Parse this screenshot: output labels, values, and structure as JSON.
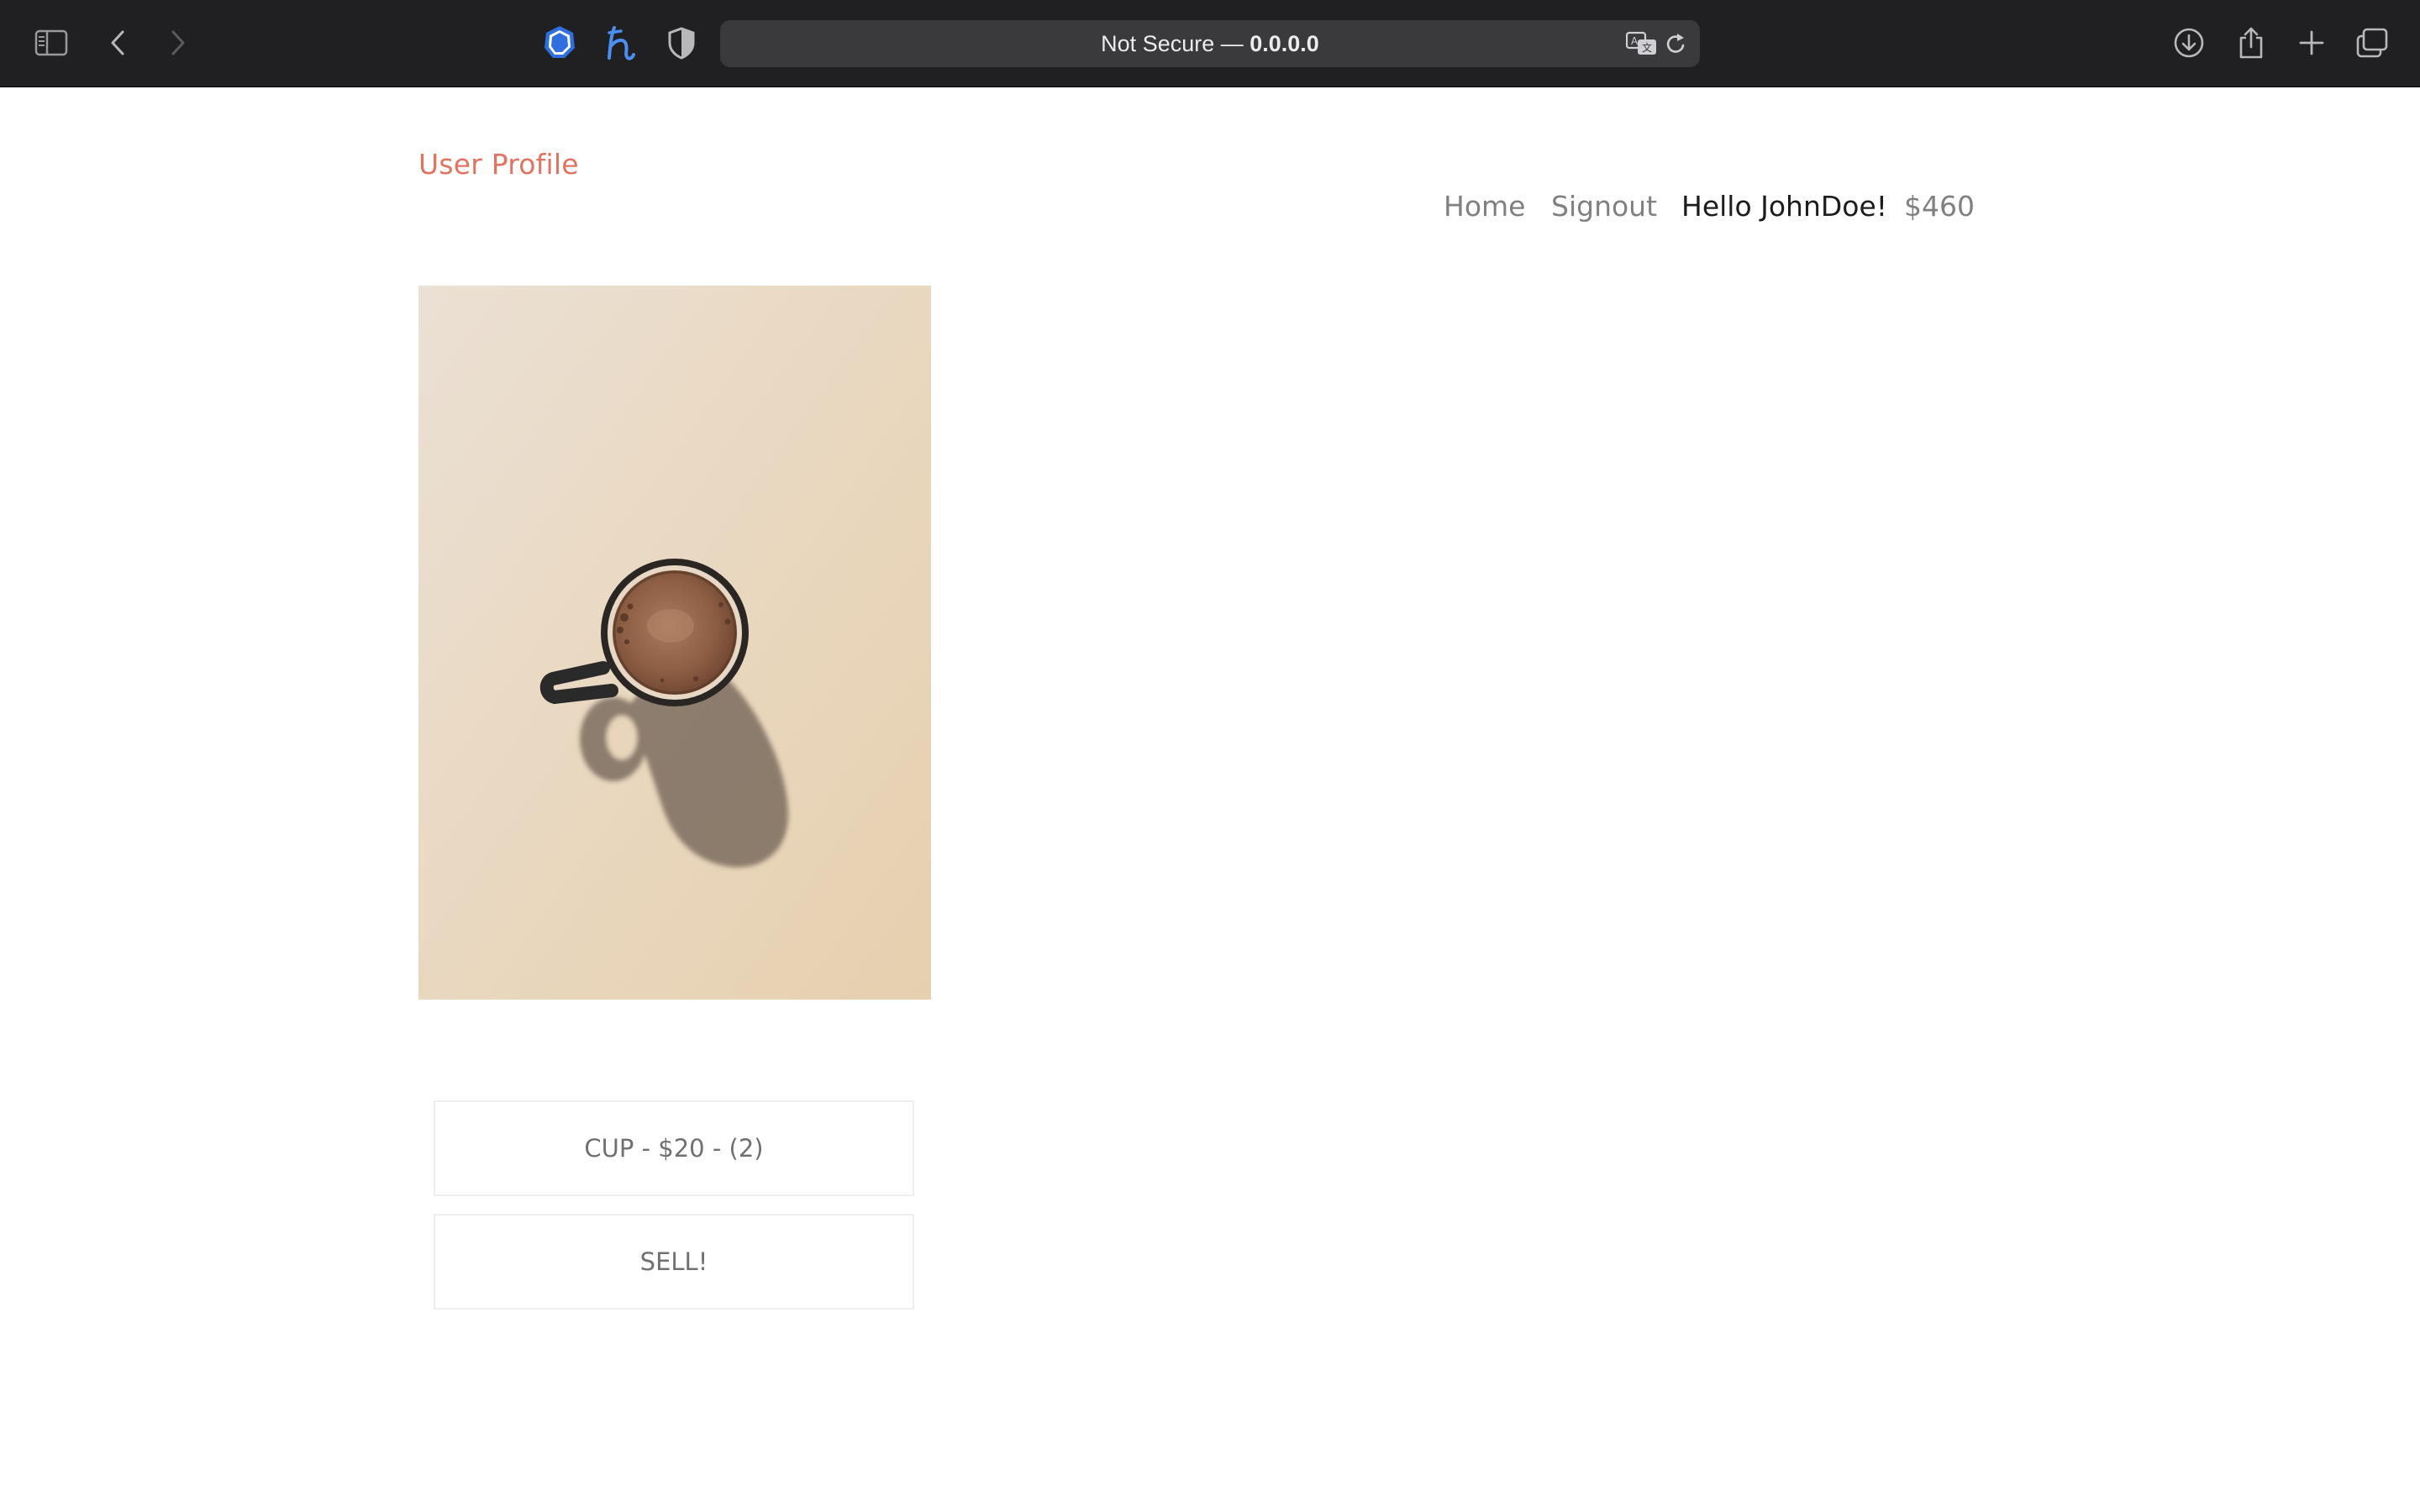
{
  "browser": {
    "address_bar": {
      "security_label": "Not Secure — ",
      "host": "0.0.0.0"
    },
    "icons": {
      "sidebar": "sidebar-icon",
      "back": "back-arrow-icon",
      "forward": "forward-arrow-icon",
      "ext1": "shield-extension-icon",
      "ext2": "h-extension-icon",
      "ext3": "privacy-shield-icon",
      "translate": "translate-icon",
      "reload": "reload-icon",
      "download": "download-icon",
      "share": "share-icon",
      "new_tab": "plus-icon",
      "tabs": "tab-overview-icon"
    }
  },
  "site": {
    "title": "User Profile",
    "nav": {
      "home": "Home",
      "signout": "Signout",
      "greeting": "Hello JohnDoe!",
      "balance": "$460"
    }
  },
  "product": {
    "image_alt": "coffee-cup-photo",
    "summary": "CUP - $20 - (2)",
    "sell_label": "SELL!"
  },
  "colors": {
    "accent": "#e2735f",
    "toolbar": "#202022",
    "nav_text": "#808080",
    "greeting_text": "#1c1c1c"
  }
}
